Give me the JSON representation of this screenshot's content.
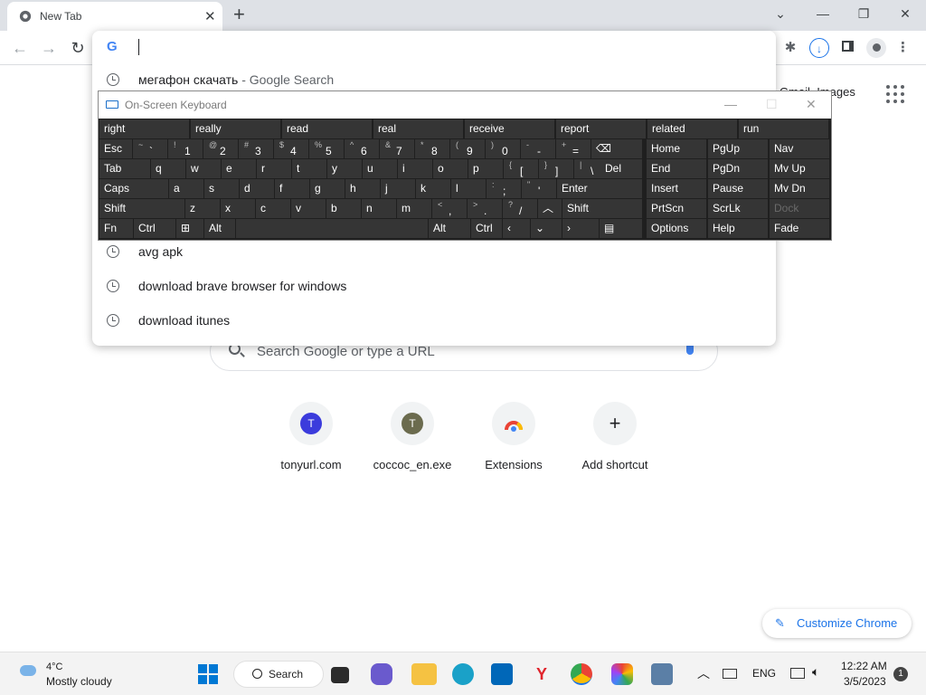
{
  "tab": {
    "title": "New Tab",
    "close": "✕",
    "new_tab": "+"
  },
  "window": {
    "chevron": "⌄",
    "minimize": "—",
    "restore": "❐",
    "close": "✕"
  },
  "toolbar": {
    "back": "←",
    "forward": "→",
    "reload": "↻"
  },
  "omnibox": {
    "engine_letter": "G",
    "value": "",
    "suggestions": [
      {
        "text": "мегафон скачать",
        "sub": " - Google Search"
      },
      {
        "text": "avg apk",
        "sub": ""
      },
      {
        "text": "download brave browser for windows",
        "sub": ""
      },
      {
        "text": "download itunes",
        "sub": ""
      }
    ]
  },
  "ntp": {
    "gmail": "Gmail",
    "images": "Images",
    "search_placeholder": "Search Google or type a URL",
    "shortcuts": [
      {
        "letter": "T",
        "label": "tonyurl.com",
        "color": "#3b3bdc"
      },
      {
        "letter": "T",
        "label": "coccoc_en.exe",
        "color": "#6b6b4e"
      },
      {
        "letter": "",
        "label": "Extensions",
        "color": "#ea4335"
      },
      {
        "letter": "+",
        "label": "Add shortcut",
        "color": "#f1f3f4"
      }
    ],
    "customize": "Customize Chrome"
  },
  "osk": {
    "title": "On-Screen Keyboard",
    "predictions": [
      "right",
      "really",
      "read",
      "real",
      "receive",
      "report",
      "related",
      "run"
    ],
    "row1": [
      [
        "~",
        "`"
      ],
      [
        "!",
        "1"
      ],
      [
        "@",
        "2"
      ],
      [
        "#",
        "3"
      ],
      [
        "$",
        "4"
      ],
      [
        "%",
        "5"
      ],
      [
        "^",
        "6"
      ],
      [
        "&",
        "7"
      ],
      [
        "*",
        "8"
      ],
      [
        "(",
        "9"
      ],
      [
        ")",
        "0"
      ],
      [
        "-",
        "-"
      ],
      [
        "+",
        "="
      ]
    ],
    "esc": "Esc",
    "tab": "Tab",
    "row2": [
      "q",
      "w",
      "e",
      "r",
      "t",
      "y",
      "u",
      "i",
      "o",
      "p"
    ],
    "row2_sym": [
      [
        "{",
        "["
      ],
      [
        "}",
        "]"
      ],
      [
        "|",
        "\\"
      ]
    ],
    "del": "Del",
    "caps": "Caps",
    "row3": [
      "a",
      "s",
      "d",
      "f",
      "g",
      "h",
      "j",
      "k",
      "l"
    ],
    "row3_sym": [
      [
        ":",
        ";"
      ],
      [
        "\"",
        "'"
      ]
    ],
    "enter": "Enter",
    "shift": "Shift",
    "row4": [
      "z",
      "x",
      "c",
      "v",
      "b",
      "n",
      "m"
    ],
    "row4_sym": [
      [
        "<",
        ","
      ],
      [
        ">",
        "."
      ],
      [
        "?",
        "/"
      ]
    ],
    "fn": "Fn",
    "ctrl": "Ctrl",
    "alt": "Alt",
    "nav_keys": [
      [
        "Home",
        "PgUp",
        "Nav"
      ],
      [
        "End",
        "PgDn",
        "Mv Up"
      ],
      [
        "Insert",
        "Pause",
        "Mv Dn"
      ],
      [
        "PrtScn",
        "ScrLk",
        "Dock"
      ],
      [
        "Options",
        "Help",
        "Fade"
      ]
    ]
  },
  "taskbar": {
    "temp": "4°C",
    "weather": "Mostly cloudy",
    "search": "Search",
    "lang": "ENG",
    "time": "12:22 AM",
    "date": "3/5/2023",
    "notif": "1"
  }
}
